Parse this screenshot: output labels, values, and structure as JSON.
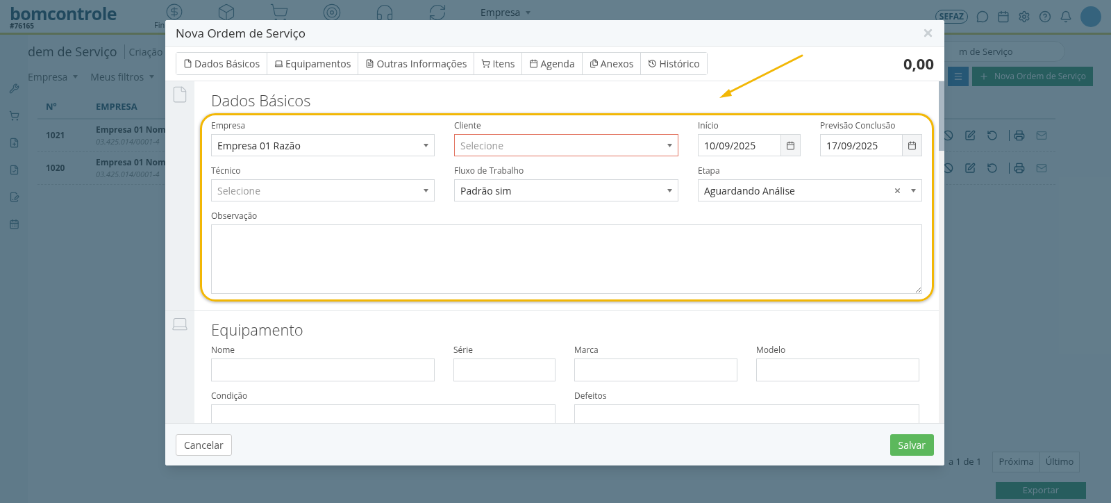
{
  "app_header": {
    "logo": "bomcontrole",
    "account_id": "#76165",
    "nav_label": "Fin",
    "menu": "Empresa",
    "sefaz_badge": "SEFAZ"
  },
  "breadcrumb": {
    "title": "dem de Serviço",
    "subtitle": "Criação"
  },
  "filters": [
    "Empresa",
    "Meus filtros"
  ],
  "search": {
    "placeholder": "m de Serviço"
  },
  "new_button": "Nova Ordem de Serviço",
  "table": {
    "columns": [
      "Nº",
      "EMPRESA"
    ],
    "rows": [
      {
        "number": "1021",
        "company": "Empresa 01 Nom",
        "document": "03.425.014/0001-4"
      },
      {
        "number": "1020",
        "company": "Empresa 01 Nom",
        "document": "03.425.014/0001-4"
      }
    ]
  },
  "pagination": {
    "page_info": "a 1 de 1",
    "next": "Próxima",
    "last": "Último"
  },
  "export_button": "Exportar",
  "modal": {
    "title": "Nova Ordem de Serviço",
    "total": "0,00",
    "tabs": [
      {
        "label": "Dados Básicos",
        "selected": false
      },
      {
        "label": "Equipamentos",
        "selected": false
      },
      {
        "label": "Outras Informações",
        "selected": false
      },
      {
        "label": "Itens",
        "selected": false
      },
      {
        "label": "Agenda",
        "selected": false
      },
      {
        "label": "Anexos",
        "selected": false
      },
      {
        "label": "Histórico",
        "selected": false
      }
    ],
    "sections": [
      {
        "title": "Dados Básicos",
        "highlighted": true,
        "fields": [
          {
            "label": "Empresa",
            "kind": "select",
            "value": "Empresa 01 Razão",
            "invalid": false
          },
          {
            "label": "Cliente",
            "kind": "select",
            "placeholder": "Selecione",
            "invalid": true
          },
          {
            "label": "Início",
            "kind": "date",
            "value": "10/09/2025",
            "invalid": false
          },
          {
            "label": "Previsão Conclusão",
            "kind": "date",
            "value": "17/09/2025",
            "invalid": false
          },
          {
            "label": "Técnico",
            "kind": "select",
            "placeholder": "Selecione",
            "invalid": false
          },
          {
            "label": "Fluxo de Trabalho",
            "kind": "select",
            "value": "Padrão sim",
            "invalid": false
          },
          {
            "label": "Etapa",
            "kind": "select",
            "value": "Aguardando Análise",
            "clearable": true,
            "invalid": false
          },
          {
            "label": "Observação",
            "kind": "textarea",
            "invalid": false
          }
        ]
      },
      {
        "title": "Equipamento",
        "highlighted": false,
        "fields": [
          {
            "label": "Nome",
            "kind": "text",
            "invalid": false
          },
          {
            "label": "Série",
            "kind": "text",
            "invalid": false
          },
          {
            "label": "Marca",
            "kind": "text",
            "invalid": false
          },
          {
            "label": "Modelo",
            "kind": "text",
            "invalid": false
          },
          {
            "label": "Condição",
            "kind": "textarea",
            "invalid": false
          },
          {
            "label": "Defeitos",
            "kind": "textarea",
            "invalid": false
          }
        ]
      }
    ],
    "buttons": {
      "cancel": "Cancelar",
      "save": "Salvar"
    }
  }
}
